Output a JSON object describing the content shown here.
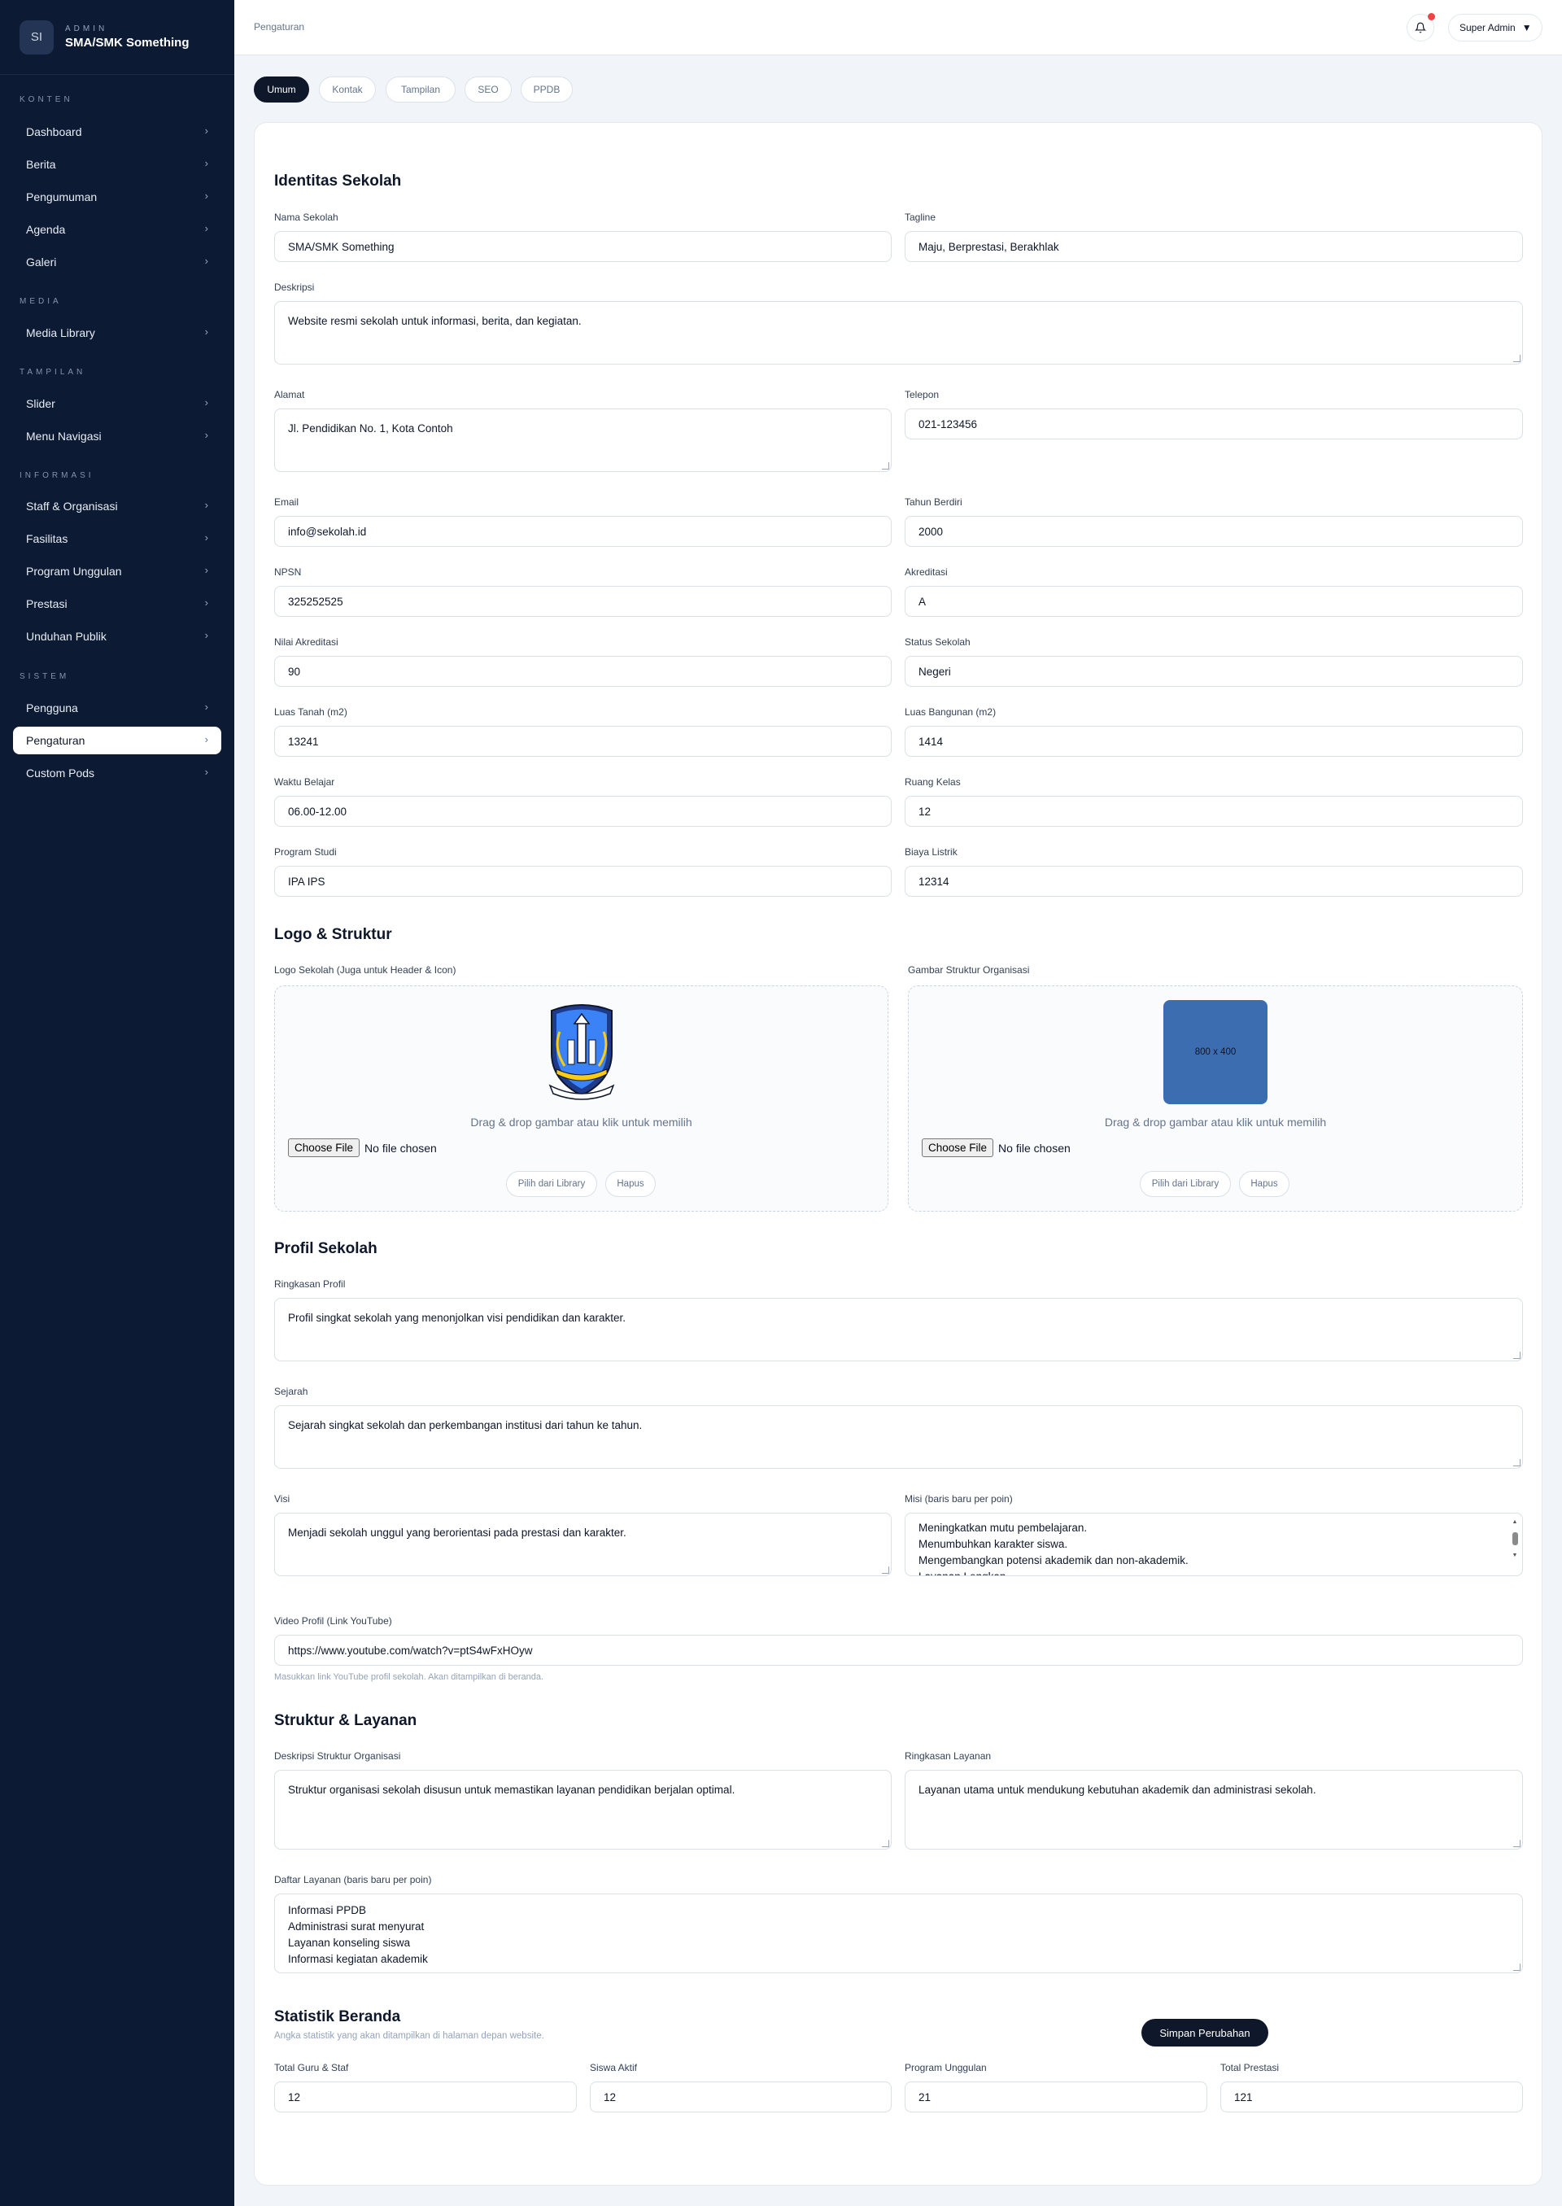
{
  "brand": {
    "initials": "SI",
    "small": "ADMIN",
    "name": "SMA/SMK Something"
  },
  "sidebar": {
    "sections": [
      {
        "title": "KONTEN",
        "items": [
          "Dashboard",
          "Berita",
          "Pengumuman",
          "Agenda",
          "Galeri"
        ]
      },
      {
        "title": "MEDIA",
        "items": [
          "Media Library"
        ]
      },
      {
        "title": "TAMPILAN",
        "items": [
          "Slider",
          "Menu Navigasi"
        ]
      },
      {
        "title": "INFORMASI",
        "items": [
          "Staff & Organisasi",
          "Fasilitas",
          "Program Unggulan",
          "Prestasi",
          "Unduhan Publik"
        ]
      },
      {
        "title": "SISTEM",
        "items": [
          "Pengguna",
          "Pengaturan",
          "Custom Pods"
        ]
      }
    ],
    "active_item": "Pengaturan",
    "chevron": "›"
  },
  "topbar": {
    "breadcrumb": "Pengaturan",
    "user": "Super Admin",
    "caret": "▼",
    "notification_icon": "bell-icon"
  },
  "tabs": [
    "Umum",
    "Kontak",
    "Tampilan",
    "SEO",
    "PPDB"
  ],
  "active_tab": "Umum",
  "identitas": {
    "title": "Identitas Sekolah",
    "nama_label": "Nama Sekolah",
    "nama": "SMA/SMK Something",
    "tagline_label": "Tagline",
    "tagline": "Maju, Berprestasi, Berakhlak",
    "deskripsi_label": "Deskripsi",
    "deskripsi": "Website resmi sekolah untuk informasi, berita, dan kegiatan.",
    "alamat_label": "Alamat",
    "alamat": "Jl. Pendidikan No. 1, Kota Contoh",
    "telepon_label": "Telepon",
    "telepon": "021-123456",
    "email_label": "Email",
    "email": "info@sekolah.id",
    "tahun_label": "Tahun Berdiri",
    "tahun": "2000",
    "npsn_label": "NPSN",
    "npsn": "325252525",
    "akreditasi_label": "Akreditasi",
    "akreditasi": "A",
    "nilai_label": "Nilai Akreditasi",
    "nilai": "90",
    "status_label": "Status Sekolah",
    "status": "Negeri",
    "tanah_label": "Luas Tanah (m2)",
    "tanah": "13241",
    "bangunan_label": "Luas Bangunan (m2)",
    "bangunan": "1414",
    "waktu_label": "Waktu Belajar",
    "waktu": "06.00-12.00",
    "ruang_label": "Ruang Kelas",
    "ruang": "12",
    "prodi_label": "Program Studi",
    "prodi": "IPA IPS",
    "listrik_label": "Biaya Listrik",
    "listrik": "12314"
  },
  "logo": {
    "title": "Logo & Struktur",
    "logo_label": "Logo Sekolah (Juga untuk Header & Icon)",
    "struktur_label": "Gambar Struktur Organisasi",
    "placeholder_text": "800 x 400",
    "drop_text": "Drag & drop gambar atau klik untuk memilih",
    "choose_file": "Choose File",
    "no_file": "No file chosen",
    "library_btn": "Pilih dari Library",
    "hapus_btn": "Hapus"
  },
  "profil": {
    "title": "Profil Sekolah",
    "ringkasan_label": "Ringkasan Profil",
    "ringkasan": "Profil singkat sekolah yang menonjolkan visi pendidikan dan karakter.",
    "sejarah_label": "Sejarah",
    "sejarah": "Sejarah singkat sekolah dan perkembangan institusi dari tahun ke tahun.",
    "visi_label": "Visi",
    "visi": "Menjadi sekolah unggul yang berorientasi pada prestasi dan karakter.",
    "misi_label": "Misi (baris baru per poin)",
    "misi": "Meningkatkan mutu pembelajaran.\nMenumbuhkan karakter siswa.\nMengembangkan potensi akademik dan non-akademik.\nLayanan Lengkap",
    "video_label": "Video Profil (Link YouTube)",
    "video": "https://www.youtube.com/watch?v=ptS4wFxHOyw",
    "video_help": "Masukkan link YouTube profil sekolah. Akan ditampilkan di beranda."
  },
  "layanan": {
    "title": "Struktur & Layanan",
    "deskripsi_label": "Deskripsi Struktur Organisasi",
    "deskripsi": "Struktur organisasi sekolah disusun untuk memastikan layanan pendidikan berjalan optimal.",
    "ringkasan_label": "Ringkasan Layanan",
    "ringkasan": "Layanan utama untuk mendukung kebutuhan akademik dan administrasi sekolah.",
    "daftar_label": "Daftar Layanan (baris baru per poin)",
    "daftar": "Informasi PPDB\nAdministrasi surat menyurat\nLayanan konseling siswa\nInformasi kegiatan akademik"
  },
  "statistik": {
    "title": "Statistik Beranda",
    "subtitle": "Angka statistik yang akan ditampilkan di halaman depan website.",
    "guru_label": "Total Guru & Staf",
    "guru": "12",
    "siswa_label": "Siswa Aktif",
    "siswa": "12",
    "program_label": "Program Unggulan",
    "program": "21",
    "prestasi_label": "Total Prestasi",
    "prestasi": "121"
  },
  "save_label": "Simpan Perubahan",
  "colors": {
    "sidebar": "#0d1a33",
    "accent": "#0f172a",
    "placeholder": "#3b6db0",
    "notification": "#ef4444"
  }
}
